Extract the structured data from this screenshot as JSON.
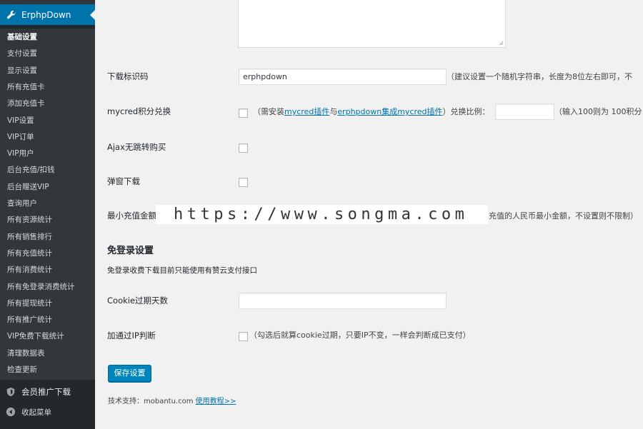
{
  "sidebar": {
    "plugin_title": "ErphpDown",
    "items": [
      {
        "label": "基础设置",
        "current": true
      },
      {
        "label": "支付设置"
      },
      {
        "label": "显示设置"
      },
      {
        "label": "所有充值卡"
      },
      {
        "label": "添加充值卡"
      },
      {
        "label": "VIP设置"
      },
      {
        "label": "VIP订单"
      },
      {
        "label": "VIP用户"
      },
      {
        "label": "后台充值/扣钱"
      },
      {
        "label": "后台赠送VIP"
      },
      {
        "label": "查询用户"
      },
      {
        "label": "所有资源统计"
      },
      {
        "label": "所有销售排行"
      },
      {
        "label": "所有充值统计"
      },
      {
        "label": "所有消费统计"
      },
      {
        "label": "所有免登录消费统计"
      },
      {
        "label": "所有提现统计"
      },
      {
        "label": "所有推广统计"
      },
      {
        "label": "VIP免费下载统计"
      },
      {
        "label": "清理数据表"
      },
      {
        "label": "检查更新"
      }
    ],
    "affiliate_menu": "会员推广下载",
    "collapse_menu": "收起菜单"
  },
  "form": {
    "download_code": {
      "label": "下载标识码",
      "value": "erphpdown",
      "hint": "（建议设置一个随机字符串，长度为8位左右即可，不"
    },
    "mycred": {
      "label": "mycred积分兑换",
      "hint_prefix": "（需安装",
      "link1": "mycred插件",
      "hint_mid": "与",
      "link2": "erphpdown集成mycred插件",
      "hint_suffix": "）兑换比例：",
      "ratio_value": "",
      "ratio_hint": "（输入100则为 100积分 ="
    },
    "ajax": {
      "label": "Ajax无跳转购买"
    },
    "popup": {
      "label": "弹窗下载"
    },
    "min_recharge": {
      "label": "最小充值金额",
      "hint": "充值的人民币最小金额，不设置则不限制）"
    },
    "free_login": {
      "section_title": "免登录设置",
      "description": "免登录收费下载目前只能使用有赞云支付接口",
      "cookie_label": "Cookie过期天数",
      "cookie_value": "",
      "ip_label": "加通过IP判断",
      "ip_hint": "（勾选后就算cookie过期，只要IP不变，一样会判断成已支付）"
    },
    "save_button": "保存设置",
    "support_prefix": "技术支持：mobantu.com",
    "support_link": "使用教程>>"
  },
  "watermark": "https://www.songma.com",
  "colors": {
    "sidebar_bg": "#23282d",
    "submenu_bg": "#32373c",
    "active_blue": "#0073aa",
    "button_blue": "#0085ba",
    "link": "#0073aa",
    "page_bg": "#f1f1f1"
  }
}
